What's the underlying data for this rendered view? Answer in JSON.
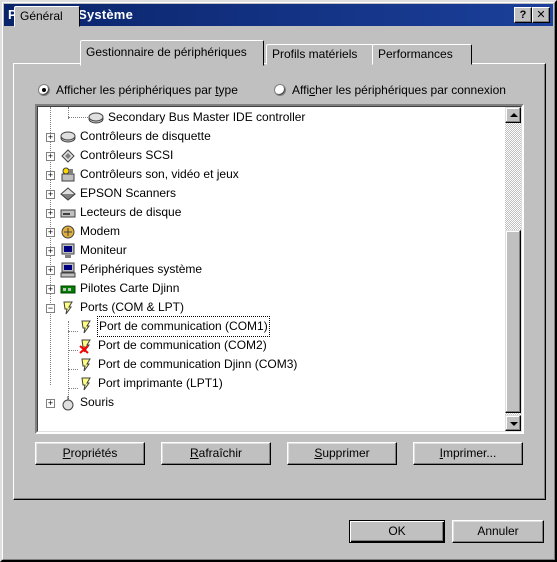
{
  "window": {
    "title": "Propriétés Système",
    "help_label": "?",
    "close_label": "✕"
  },
  "tabs": [
    {
      "label": "Général"
    },
    {
      "label": "Gestionnaire de périphériques"
    },
    {
      "label": "Profils matériels"
    },
    {
      "label": "Performances"
    }
  ],
  "view": {
    "by_type_pre": "Afficher les périphériques par ",
    "by_type_key": "t",
    "by_type_post": "ype",
    "by_connection_pre": "Affi",
    "by_connection_key": "c",
    "by_connection_post": "her les périphériques par connexion",
    "selected": "by_type"
  },
  "tree": [
    {
      "label": "Secondary Bus Master IDE controller",
      "icon": "ide-controller-icon"
    },
    {
      "label": "Contrôleurs de disquette",
      "icon": "floppy-controller-icon"
    },
    {
      "label": "Contrôleurs SCSI",
      "icon": "scsi-controller-icon"
    },
    {
      "label": "Contrôleurs son, vidéo et jeux",
      "icon": "sound-video-game-icon"
    },
    {
      "label": "EPSON Scanners",
      "icon": "scanner-icon"
    },
    {
      "label": "Lecteurs de disque",
      "icon": "disk-drive-icon"
    },
    {
      "label": "Modem",
      "icon": "modem-icon"
    },
    {
      "label": "Moniteur",
      "icon": "monitor-icon"
    },
    {
      "label": "Périphériques système",
      "icon": "system-device-icon"
    },
    {
      "label": "Pilotes Carte Djinn",
      "icon": "card-driver-icon"
    },
    {
      "label": "Ports (COM & LPT)",
      "icon": "port-icon"
    },
    {
      "label": "Port de communication (COM1)",
      "icon": "port-icon"
    },
    {
      "label": "Port de communication (COM2)",
      "icon": "port-disabled-icon"
    },
    {
      "label": "Port de communication Djinn (COM3)",
      "icon": "port-icon"
    },
    {
      "label": "Port imprimante  (LPT1)",
      "icon": "port-icon"
    },
    {
      "label": "Souris",
      "icon": "mouse-icon"
    }
  ],
  "actions": {
    "properties": {
      "key": "P",
      "rest": "ropriétés"
    },
    "refresh": {
      "key": "R",
      "rest": "afraîchir"
    },
    "remove": {
      "key": "S",
      "rest": "upprimer"
    },
    "print": {
      "key": "I",
      "rest": "mprimer..."
    }
  },
  "footer": {
    "ok": "OK",
    "cancel": "Annuler"
  }
}
